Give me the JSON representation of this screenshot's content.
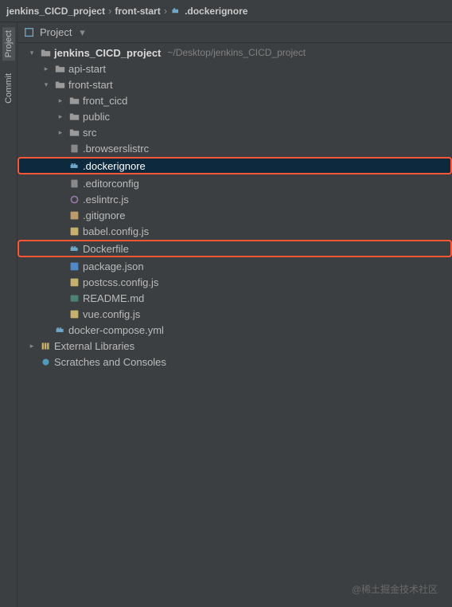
{
  "breadcrumb": {
    "items": [
      "jenkins_CICD_project",
      "front-start",
      ".dockerignore"
    ]
  },
  "leftRail": {
    "tabs": [
      "Project",
      "Commit"
    ]
  },
  "projectHeader": {
    "label": "Project"
  },
  "tree": {
    "nodes": [
      {
        "indent": 0,
        "chevron": "down",
        "icon": "folder",
        "label": "jenkins_CICD_project",
        "bold": true,
        "path": "~/Desktop/jenkins_CICD_project"
      },
      {
        "indent": 1,
        "chevron": "right",
        "icon": "folder",
        "label": "api-start"
      },
      {
        "indent": 1,
        "chevron": "down",
        "icon": "folder",
        "label": "front-start"
      },
      {
        "indent": 2,
        "chevron": "right",
        "icon": "folder",
        "label": "front_cicd"
      },
      {
        "indent": 2,
        "chevron": "right",
        "icon": "folder",
        "label": "public"
      },
      {
        "indent": 2,
        "chevron": "right",
        "icon": "folder",
        "label": "src"
      },
      {
        "indent": 2,
        "chevron": "none",
        "icon": "file",
        "label": ".browserslistrc"
      },
      {
        "indent": 2,
        "chevron": "none",
        "icon": "docker",
        "label": ".dockerignore",
        "selected": true,
        "highlight": true
      },
      {
        "indent": 2,
        "chevron": "none",
        "icon": "file",
        "label": ".editorconfig"
      },
      {
        "indent": 2,
        "chevron": "none",
        "icon": "o",
        "label": ".eslintrc.js"
      },
      {
        "indent": 2,
        "chevron": "none",
        "icon": "git",
        "label": ".gitignore"
      },
      {
        "indent": 2,
        "chevron": "none",
        "icon": "js",
        "label": "babel.config.js"
      },
      {
        "indent": 2,
        "chevron": "none",
        "icon": "docker",
        "label": "Dockerfile",
        "highlight": true
      },
      {
        "indent": 2,
        "chevron": "none",
        "icon": "json",
        "label": "package.json"
      },
      {
        "indent": 2,
        "chevron": "none",
        "icon": "js",
        "label": "postcss.config.js"
      },
      {
        "indent": 2,
        "chevron": "none",
        "icon": "md",
        "label": "README.md"
      },
      {
        "indent": 2,
        "chevron": "none",
        "icon": "js",
        "label": "vue.config.js"
      },
      {
        "indent": 1,
        "chevron": "none",
        "icon": "docker",
        "label": "docker-compose.yml"
      },
      {
        "indent": 0,
        "chevron": "right",
        "icon": "lib",
        "label": "External Libraries"
      },
      {
        "indent": 0,
        "chevron": "none",
        "icon": "scratch",
        "label": "Scratches and Consoles"
      }
    ]
  },
  "watermark": "@稀土掘金技术社区"
}
